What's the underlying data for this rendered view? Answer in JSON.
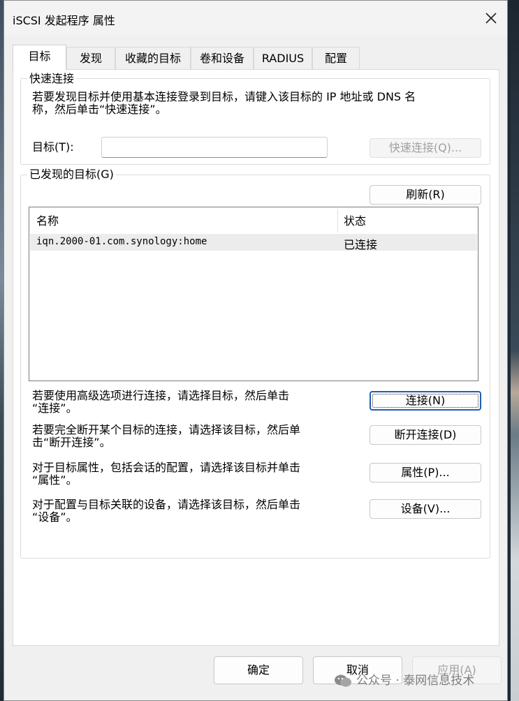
{
  "window": {
    "title": "iSCSI 发起程序 属性"
  },
  "tabs": [
    {
      "label": "目标",
      "active": true
    },
    {
      "label": "发现",
      "active": false
    },
    {
      "label": "收藏的目标",
      "active": false
    },
    {
      "label": "卷和设备",
      "active": false
    },
    {
      "label": "RADIUS",
      "active": false
    },
    {
      "label": "配置",
      "active": false
    }
  ],
  "quick_connect": {
    "legend": "快速连接",
    "description_line1": "若要发现目标并使用基本连接登录到目标，请键入该目标的 IP 地址或 DNS 名",
    "description_line2": "称，然后单击“快速连接”。",
    "target_label": "目标(T):",
    "target_value": "",
    "button_label": "快速连接(Q)..."
  },
  "discovered": {
    "legend": "已发现的目标(G)",
    "refresh_label": "刷新(R)",
    "columns": [
      "名称",
      "状态"
    ],
    "rows": [
      {
        "name": "iqn.2000-01.com.synology:home",
        "status": "已连接"
      }
    ]
  },
  "actions": [
    {
      "line1": "若要使用高级选项进行连接，请选择目标，然后单击",
      "line2": "“连接”。",
      "button": "连接(N)"
    },
    {
      "line1": "若要完全断开某个目标的连接，请选择该目标，然后单",
      "line2": "击“断开连接”。",
      "button": "断开连接(D)"
    },
    {
      "line1": "对于目标属性，包括会话的配置，请选择该目标并单击",
      "line2": "“属性”。",
      "button": "属性(P)..."
    },
    {
      "line1": "对于配置与目标关联的设备，请选择该目标，然后单击",
      "line2": "“设备”。",
      "button": "设备(V)..."
    }
  ],
  "footer": {
    "ok": "确定",
    "cancel": "取消",
    "apply": "应用(A)"
  },
  "watermark": "公众号 · 泰网信息技术",
  "colors": {
    "window_bg": "#f0f0f0",
    "panel_bg": "#ffffff",
    "focus_border": "#1f5fb0",
    "disabled_text": "#a0a0a0"
  }
}
